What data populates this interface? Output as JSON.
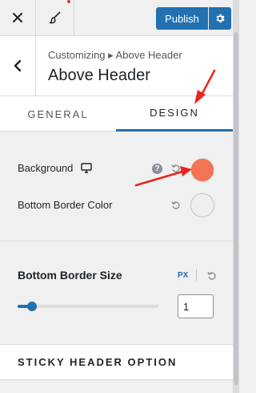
{
  "topbar": {
    "close_icon": "close-icon",
    "brush_icon": "paintbrush-icon",
    "publish_label": "Publish",
    "publish_settings_icon": "gear-icon"
  },
  "section": {
    "breadcrumb": "Customizing ▸ Above Header",
    "title": "Above Header",
    "back_icon": "chevron-left-icon"
  },
  "tabs": [
    {
      "label": "GENERAL",
      "active": false
    },
    {
      "label": "DESIGN",
      "active": true
    }
  ],
  "controls": {
    "background": {
      "label": "Background",
      "device_icon": "desktop-icon",
      "help": "?",
      "color": "#f37355"
    },
    "bottom_border_color": {
      "label": "Bottom Border Color",
      "color": "#efefef"
    },
    "bottom_border_size": {
      "label": "Bottom Border Size",
      "unit": "PX",
      "value": "1",
      "slider_fraction": 0.1
    }
  },
  "sticky_section": {
    "label": "STICKY HEADER OPTION"
  },
  "colors": {
    "accent": "#2271b1",
    "annotation_arrow": "#e8251f"
  }
}
